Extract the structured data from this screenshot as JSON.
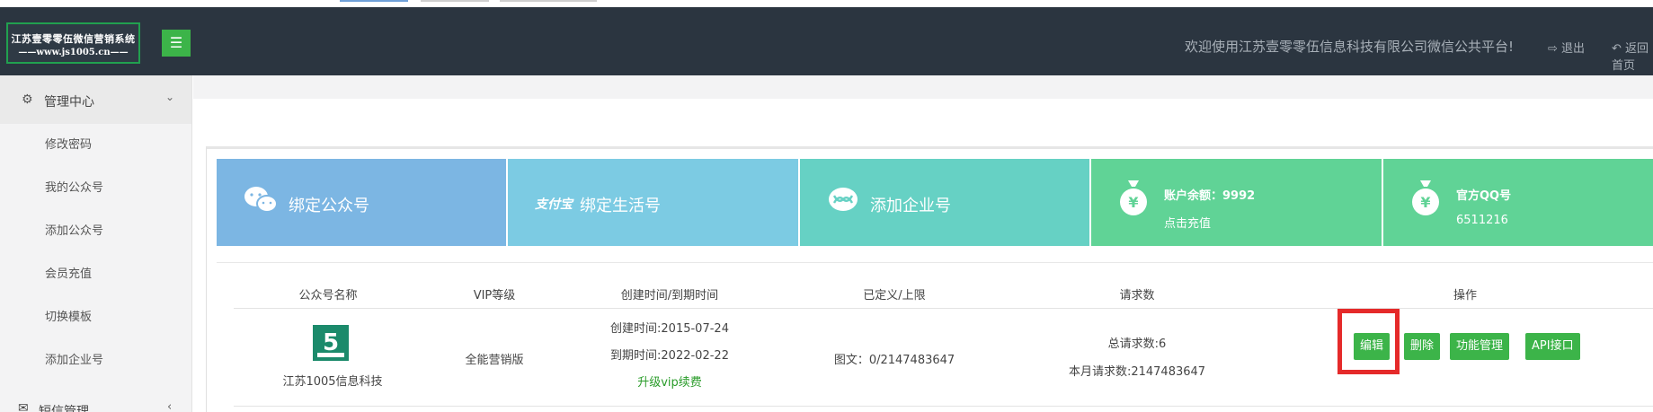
{
  "header": {
    "logo_line1": "江苏壹零零伍微信营销系统",
    "logo_line2": "——www.js1005.cn——",
    "welcome": "欢迎使用江苏壹零零伍信息科技有限公司微信公共平台!",
    "logout": "退出",
    "back": "返回首页"
  },
  "sidebar": {
    "section": "管理中心",
    "items": [
      "修改密码",
      "我的公众号",
      "添加公众号",
      "会员充值",
      "切换模板",
      "添加企业号"
    ],
    "next_section": "短信管理"
  },
  "tiles": {
    "bind_wechat": "绑定公众号",
    "bind_life": "绑定生活号",
    "add_enterprise": "添加企业号",
    "balance": "账户余额：9992",
    "recharge": "点击充值",
    "qq_label": "官方QQ号",
    "qq_value": "6511216",
    "alipay_logo": "支付宝"
  },
  "table": {
    "headers": {
      "name": "公众号名称",
      "vip": "VIP等级",
      "time": "创建时间/到期时间",
      "limit": "已定义/上限",
      "requests": "请求数",
      "actions": "操作"
    },
    "row": {
      "name": "江苏1005信息科技",
      "vip": "全能营销版",
      "created": "创建时间:2015-07-24",
      "expires": "到期时间:2022-02-22",
      "upgrade": "升级vip续费",
      "limit": "图文：0/2147483647",
      "total_requests": "总请求数:6",
      "month_requests": "本月请求数:2147483647"
    },
    "actions": {
      "edit": "编辑",
      "delete": "删除",
      "function": "功能管理",
      "api": "API接口"
    }
  },
  "colors": {
    "header_bg": "#2b3540",
    "accent_green": "#3cb449",
    "highlight_red": "#e52a2a"
  }
}
